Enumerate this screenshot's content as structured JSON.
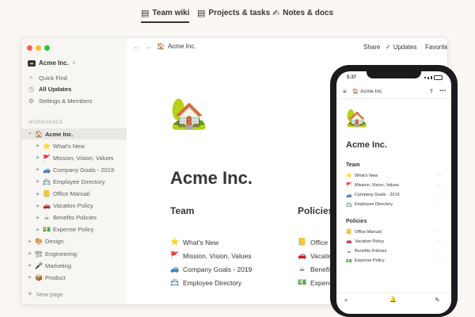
{
  "topnav": {
    "tabs": [
      {
        "label": "Team wiki",
        "icon": "notebook-icon",
        "glyph": "▤"
      },
      {
        "label": "Projects & tasks",
        "icon": "notebook-icon",
        "glyph": "▤"
      },
      {
        "label": "Notes & docs",
        "icon": "pencil-icon",
        "glyph": "✍"
      }
    ]
  },
  "window": {
    "traffic_lights": [
      "#ff5f57",
      "#febc2e",
      "#28c840"
    ],
    "sidebar": {
      "workspace_name": "Acme Inc.",
      "workspace_chevron": "⇕",
      "menu": [
        {
          "label": "Quick Find",
          "glyph": "⌕"
        },
        {
          "label": "All Updates",
          "glyph": "◷"
        },
        {
          "label": "Settings & Members",
          "glyph": "⚙"
        }
      ],
      "section_label": "WORKSPACE",
      "tree": [
        {
          "label": "Acme Inc.",
          "emoji": "🏠",
          "arrow": "▼"
        },
        {
          "label": "What's New",
          "emoji": "⭐",
          "arrow": "▶"
        },
        {
          "label": "Mission, Vision, Values",
          "emoji": "🚩",
          "arrow": "▶"
        },
        {
          "label": "Company Goals - 2019",
          "emoji": "🚙",
          "arrow": "▶"
        },
        {
          "label": "Employee Directory",
          "emoji": "📇",
          "arrow": "▶"
        },
        {
          "label": "Office Manual",
          "emoji": "📒",
          "arrow": "▶"
        },
        {
          "label": "Vacation Policy",
          "emoji": "🚗",
          "arrow": "▶"
        },
        {
          "label": "Benefits Policies",
          "emoji": "☕",
          "arrow": "▶"
        },
        {
          "label": "Expense Policy",
          "emoji": "💵",
          "arrow": "▶"
        },
        {
          "label": "Design",
          "emoji": "🎨",
          "arrow": "▶"
        },
        {
          "label": "Engineering",
          "emoji": "🏗",
          "arrow": "▶"
        },
        {
          "label": "Marketing",
          "emoji": "🎤",
          "arrow": "▶"
        },
        {
          "label": "Product",
          "emoji": "📦",
          "arrow": "▶"
        }
      ],
      "new_page": "New page",
      "new_page_glyph": "+"
    },
    "topbar": {
      "back": "←",
      "forward": "→",
      "breadcrumb_emoji": "🏠",
      "breadcrumb": "Acme Inc.",
      "share": "Share",
      "updates_check": "✓",
      "updates": "Updates",
      "favorite": "Favorite",
      "more": "•••"
    },
    "page": {
      "icon": "🏡",
      "title": "Acme Inc.",
      "team_heading": "Team",
      "team_links": [
        {
          "emoji": "⭐",
          "label": "What's New"
        },
        {
          "emoji": "🚩",
          "label": "Mission, Vision, Values"
        },
        {
          "emoji": "🚙",
          "label": "Company Goals - 2019"
        },
        {
          "emoji": "📇",
          "label": "Employee Directory"
        }
      ],
      "policies_heading": "Policies",
      "policies_links": [
        {
          "emoji": "📒",
          "label": "Office Manual"
        },
        {
          "emoji": "🚗",
          "label": "Vacation Policy"
        },
        {
          "emoji": "☕",
          "label": "Benefits Policies"
        },
        {
          "emoji": "💵",
          "label": "Expense Policy"
        }
      ]
    }
  },
  "phone": {
    "time": "5:37",
    "menu": "≡",
    "breadcrumb_emoji": "🏠",
    "breadcrumb": "Acme Inc.",
    "share": "⇪",
    "more": "⋯",
    "icon": "🏡",
    "title": "Acme Inc.",
    "team_heading": "Team",
    "team": [
      {
        "emoji": "⭐",
        "label": "What's New"
      },
      {
        "emoji": "🚩",
        "label": "Mission, Vision, Values"
      },
      {
        "emoji": "🚙",
        "label": "Company Goals - 2019"
      },
      {
        "emoji": "📇",
        "label": "Employee Directory"
      }
    ],
    "policies_heading": "Policies",
    "policies": [
      {
        "emoji": "📒",
        "label": "Office Manual"
      },
      {
        "emoji": "🚗",
        "label": "Vacation Policy"
      },
      {
        "emoji": "☕",
        "label": "Benefits Policies"
      },
      {
        "emoji": "💵",
        "label": "Expense Policy"
      }
    ],
    "row_more": "⋯",
    "bottom": {
      "search": "⌕",
      "bell": "🔔",
      "compose": "✎"
    }
  }
}
